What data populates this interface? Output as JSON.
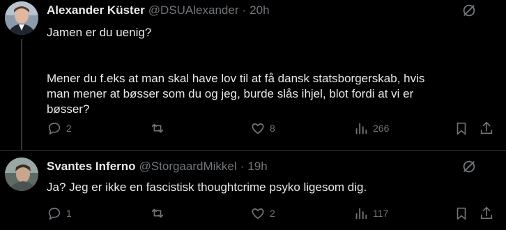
{
  "tweets": [
    {
      "name": "Alexander Küster",
      "handle": "@DSUAlexander",
      "sep": "·",
      "time": "20h",
      "lines": [
        "Jamen er du uenig?",
        "",
        "Mener du f.eks at man skal have lov til at få dansk statsborgerskab, hvis",
        "man mener at bøsser som du og jeg, burde slås ihjel,  blot fordi at vi er",
        "bøsser?"
      ],
      "replies": "2",
      "reposts": "",
      "likes": "8",
      "views": "266"
    },
    {
      "name": "Svantes Inferno",
      "handle": "@StorgaardMikkel",
      "sep": "·",
      "time": "19h",
      "lines": [
        "Ja? Jeg er ikke en fascistisk thoughtcrime psyko ligesom dig."
      ],
      "replies": "1",
      "reposts": "",
      "likes": "2",
      "views": "117"
    }
  ],
  "icons": {
    "reply": "reply-icon",
    "repost": "repost-icon",
    "like": "like-icon",
    "views": "views-icon",
    "bookmark": "bookmark-icon",
    "share": "share-icon",
    "grok": "grok-icon"
  },
  "colors": {
    "background": "#000000",
    "text": "#e7e9ea",
    "muted": "#71767b",
    "divider": "#2f3336"
  }
}
